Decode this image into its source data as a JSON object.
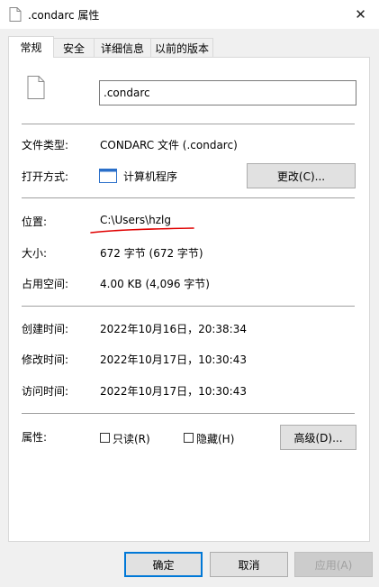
{
  "window": {
    "title": ".condarc 属性",
    "close_glyph": "✕"
  },
  "tabs": [
    {
      "label": "常规"
    },
    {
      "label": "安全"
    },
    {
      "label": "详细信息"
    },
    {
      "label": "以前的版本"
    }
  ],
  "general": {
    "file_name": ".condarc",
    "file_type": {
      "label": "文件类型:",
      "value": "CONDARC 文件 (.condarc)"
    },
    "opens_with": {
      "label": "打开方式:",
      "value": "计算机程序",
      "change_button": "更改(C)..."
    },
    "location": {
      "label": "位置:",
      "value": "C:\\Users\\hzlg"
    },
    "size": {
      "label": "大小:",
      "value": "672 字节 (672 字节)"
    },
    "size_on_disk": {
      "label": "占用空间:",
      "value": "4.00 KB (4,096 字节)"
    },
    "created": {
      "label": "创建时间:",
      "value": "2022年10月16日，20:38:34"
    },
    "modified": {
      "label": "修改时间:",
      "value": "2022年10月17日，10:30:43"
    },
    "accessed": {
      "label": "访问时间:",
      "value": "2022年10月17日，10:30:43"
    },
    "attributes": {
      "label": "属性:",
      "readonly": "只读(R)",
      "readonly_checked": false,
      "hidden": "隐藏(H)",
      "hidden_checked": false,
      "advanced_button": "高级(D)..."
    }
  },
  "footer": {
    "ok": "确定",
    "cancel": "取消",
    "apply": "应用(A)"
  },
  "annotation_color": "#e00000"
}
